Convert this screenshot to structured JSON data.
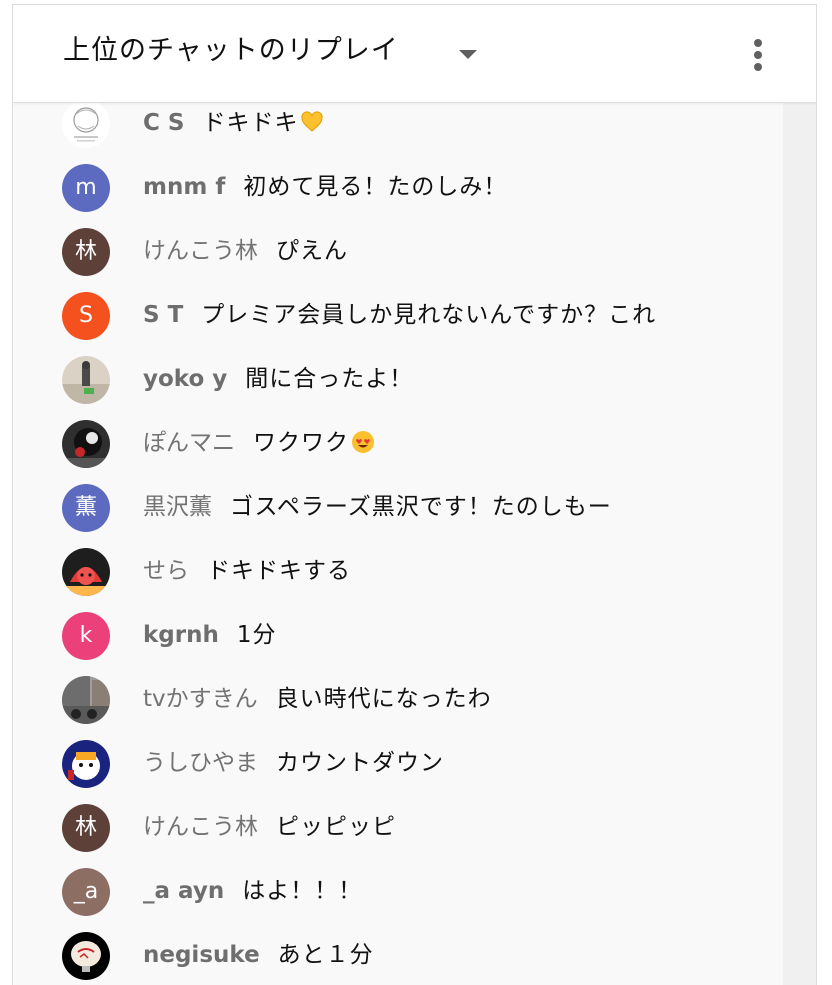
{
  "header": {
    "title": "上位のチャットのリプレイ",
    "dropdown_icon": "caret-down-icon",
    "menu_icon": "more-vertical-icon"
  },
  "colors": {
    "accent_blue": "#5c6bc0",
    "brown": "#5d4037",
    "orange": "#f4511e",
    "pink": "#ec407a",
    "taupe": "#8d6e63"
  },
  "messages": [
    {
      "author": "C S",
      "text": "ドキドキ",
      "emoji": "yellow-heart-icon",
      "avatar": {
        "kind": "image",
        "icon": "sketch-avatar-icon"
      }
    },
    {
      "author": "mnm f",
      "text": "初めて見る！たのしみ！",
      "avatar": {
        "kind": "letter",
        "letter": "m",
        "color": "#5c6bc0"
      }
    },
    {
      "author": "けんこう林",
      "text": "ぴえん",
      "avatar": {
        "kind": "letter",
        "letter": "林",
        "color": "#5d4037"
      }
    },
    {
      "author": "S T",
      "text": "プレミア会員しか見れないんですか？これ",
      "avatar": {
        "kind": "letter",
        "letter": "S",
        "color": "#f4511e"
      }
    },
    {
      "author": "yoko y",
      "text": "間に合ったよ！",
      "avatar": {
        "kind": "image",
        "icon": "photo-avatar-icon"
      }
    },
    {
      "author": "ぽんマニ",
      "text": "ワクワク",
      "emoji": "heart-eyes-emoji-icon",
      "avatar": {
        "kind": "image",
        "icon": "dog-photo-avatar-icon"
      }
    },
    {
      "author": "黒沢薫",
      "text": "ゴスペラーズ黒沢です！たのしもー",
      "avatar": {
        "kind": "letter",
        "letter": "薫",
        "color": "#5c6bc0"
      }
    },
    {
      "author": "せら",
      "text": "ドキドキする",
      "avatar": {
        "kind": "image",
        "icon": "red-character-avatar-icon"
      }
    },
    {
      "author": "kgrnh",
      "text": "1分",
      "avatar": {
        "kind": "letter",
        "letter": "k",
        "color": "#ec407a"
      }
    },
    {
      "author": "tvかすきん",
      "text": "良い時代になったわ",
      "avatar": {
        "kind": "image",
        "icon": "street-photo-avatar-icon"
      }
    },
    {
      "author": "うしひやま",
      "text": "カウントダウン",
      "avatar": {
        "kind": "image",
        "icon": "mascot-avatar-icon"
      }
    },
    {
      "author": "けんこう林",
      "text": "ピッピッピ",
      "avatar": {
        "kind": "letter",
        "letter": "林",
        "color": "#5d4037"
      }
    },
    {
      "author": "_a ayn",
      "text": "はよ！！！",
      "avatar": {
        "kind": "letter",
        "letter": "_a",
        "color": "#8d6e63"
      }
    },
    {
      "author": "negisuke",
      "text": "あと１分",
      "avatar": {
        "kind": "image",
        "icon": "lantern-photo-avatar-icon"
      }
    }
  ]
}
